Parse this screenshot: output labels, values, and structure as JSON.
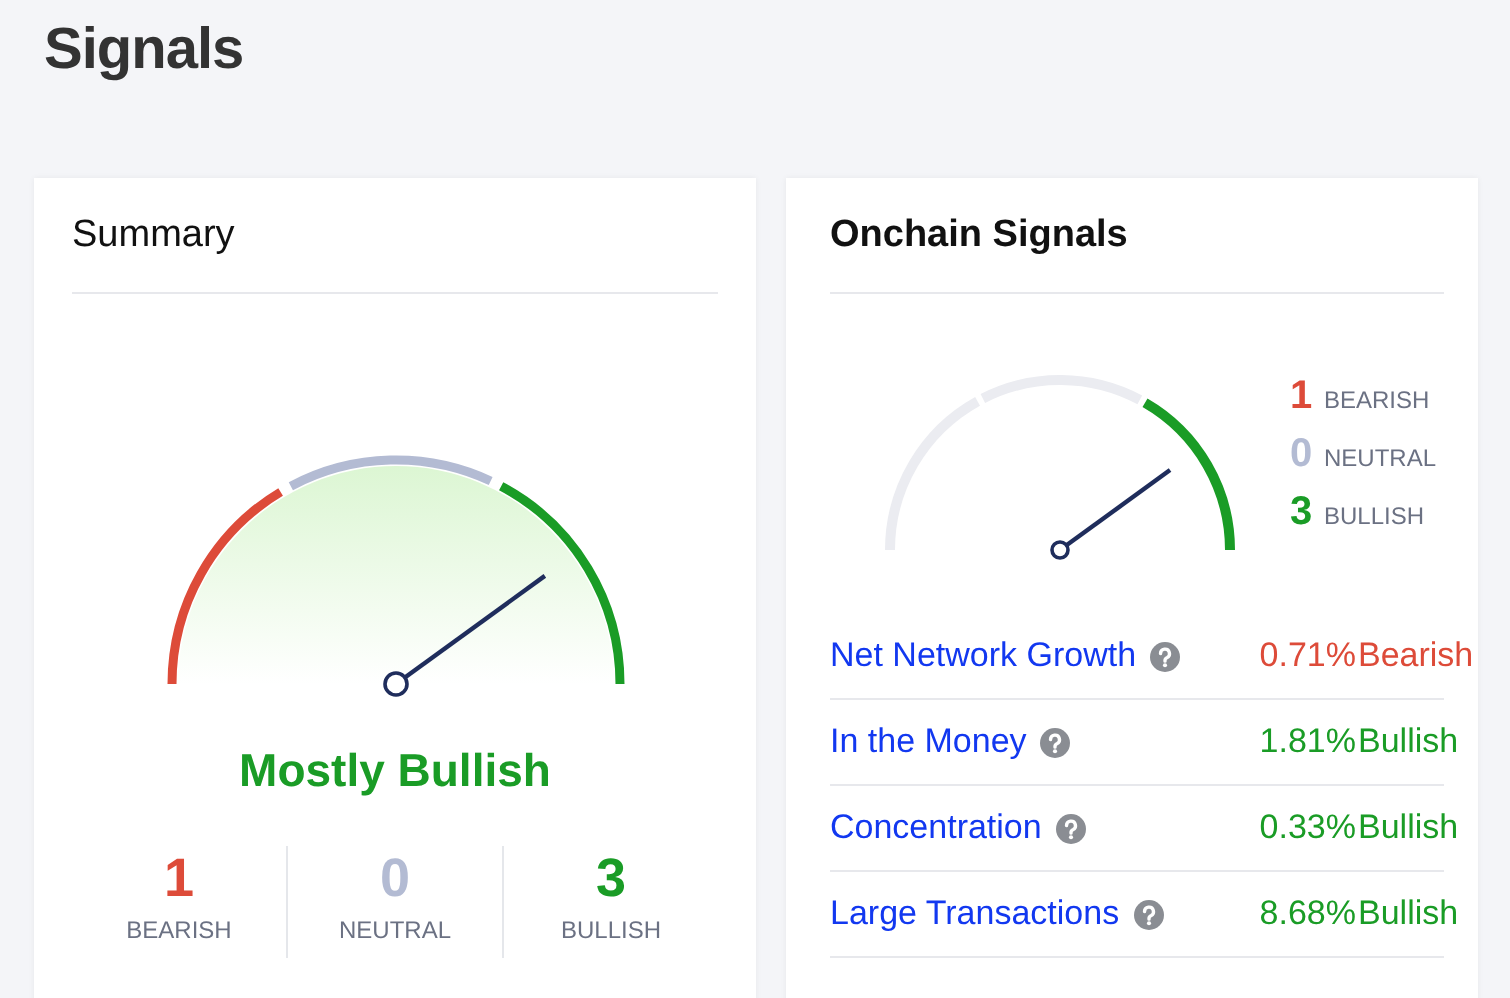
{
  "page_title": "Signals",
  "summary": {
    "title": "Summary",
    "verdict": "Mostly Bullish",
    "counts": [
      {
        "kind": "bearish",
        "value": "1",
        "label": "BEARISH"
      },
      {
        "kind": "neutral",
        "value": "0",
        "label": "NEUTRAL"
      },
      {
        "kind": "bullish",
        "value": "3",
        "label": "BULLISH"
      }
    ]
  },
  "onchain": {
    "title": "Onchain Signals",
    "counts": [
      {
        "kind": "bearish",
        "value": "1",
        "label": "BEARISH"
      },
      {
        "kind": "neutral",
        "value": "0",
        "label": "NEUTRAL"
      },
      {
        "kind": "bullish",
        "value": "3",
        "label": "BULLISH"
      }
    ],
    "rows": [
      {
        "name": "Net Network Growth",
        "value": "0.71%",
        "kind": "bearish",
        "signal": "Bearish"
      },
      {
        "name": "In the Money",
        "value": "1.81%",
        "kind": "bullish",
        "signal": "Bullish"
      },
      {
        "name": "Concentration",
        "value": "0.33%",
        "kind": "bullish",
        "signal": "Bullish"
      },
      {
        "name": "Large Transactions",
        "value": "8.68%",
        "kind": "bullish",
        "signal": "Bullish"
      }
    ]
  }
}
